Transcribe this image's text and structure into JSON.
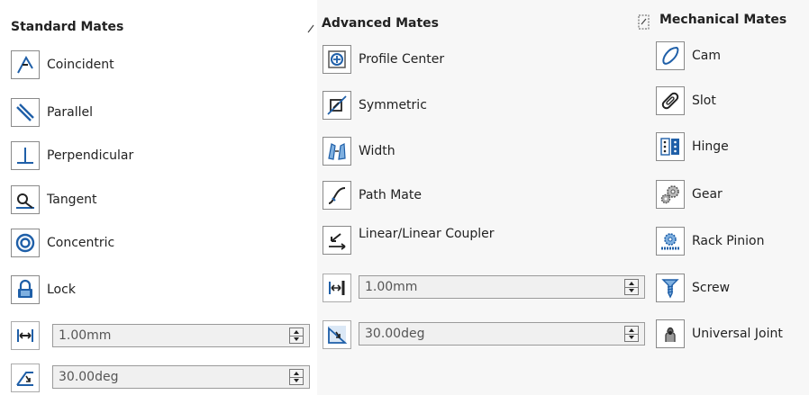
{
  "standard": {
    "title": "Standard Mates",
    "items": [
      {
        "label": "Coincident",
        "icon": "coincident-icon"
      },
      {
        "label": "Parallel",
        "icon": "parallel-icon"
      },
      {
        "label": "Perpendicular",
        "icon": "perpendicular-icon"
      },
      {
        "label": "Tangent",
        "icon": "tangent-icon"
      },
      {
        "label": "Concentric",
        "icon": "concentric-icon"
      },
      {
        "label": "Lock",
        "icon": "lock-icon"
      }
    ],
    "distance_value": "1.00mm",
    "angle_value": "30.00deg"
  },
  "advanced": {
    "title": "Advanced Mates",
    "items": [
      {
        "label": "Profile Center",
        "icon": "profile-center-icon"
      },
      {
        "label": "Symmetric",
        "icon": "symmetric-icon"
      },
      {
        "label": "Width",
        "icon": "width-icon"
      },
      {
        "label": "Path Mate",
        "icon": "path-mate-icon"
      },
      {
        "label": "Linear/Linear Coupler",
        "icon": "linear-coupler-icon"
      }
    ],
    "distance_value": "1.00mm",
    "angle_value": "30.00deg"
  },
  "mechanical": {
    "title": "Mechanical Mates",
    "items": [
      {
        "label": "Cam",
        "icon": "cam-icon"
      },
      {
        "label": "Slot",
        "icon": "slot-icon"
      },
      {
        "label": "Hinge",
        "icon": "hinge-icon"
      },
      {
        "label": "Gear",
        "icon": "gear-icon"
      },
      {
        "label": "Rack Pinion",
        "icon": "rack-pinion-icon"
      },
      {
        "label": "Screw",
        "icon": "screw-icon"
      },
      {
        "label": "Universal Joint",
        "icon": "universal-joint-icon"
      }
    ]
  },
  "colors": {
    "icon_blue": "#1f5fa8",
    "icon_dark": "#222222",
    "field_bg": "#f0f0f0"
  }
}
